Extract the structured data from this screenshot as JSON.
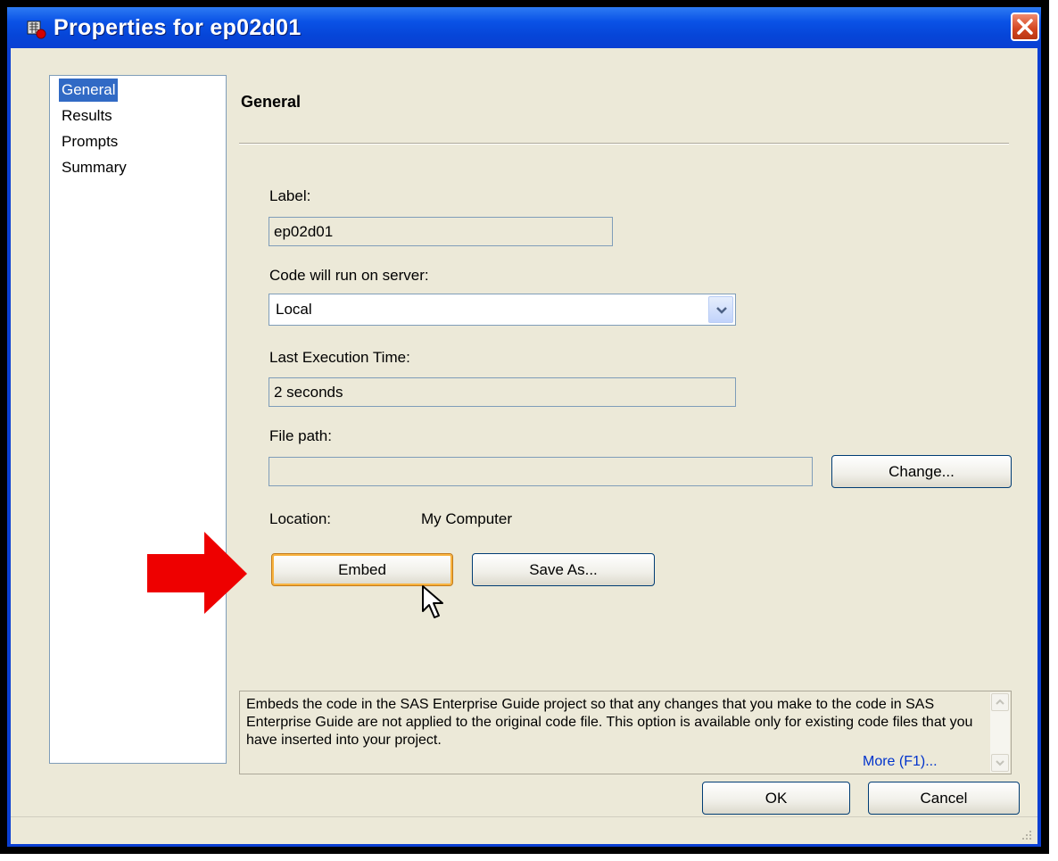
{
  "window": {
    "title": "Properties for ep02d01",
    "close_label": "Close"
  },
  "nav": {
    "items": [
      "General",
      "Results",
      "Prompts",
      "Summary"
    ],
    "selected": "General"
  },
  "section": {
    "title": "General"
  },
  "form": {
    "label_caption": "Label:",
    "label_value": "ep02d01",
    "server_caption": "Code will run on server:",
    "server_value": "Local",
    "exec_caption": "Last Execution Time:",
    "exec_value": "2 seconds",
    "filepath_caption": "File path:",
    "filepath_value": "",
    "change_button": "Change...",
    "location_caption": "Location:",
    "location_value": "My Computer",
    "embed_button": "Embed",
    "saveas_button": "Save As..."
  },
  "help": {
    "text": "Embeds the code in the SAS Enterprise Guide project so that any changes that you make to the code in SAS Enterprise Guide are not applied to the original code file. This option is available only for existing code files that you have inserted into your project.",
    "more_link": "More (F1)..."
  },
  "footer": {
    "ok_button": "OK",
    "cancel_button": "Cancel"
  },
  "colors": {
    "titlebar": "#0a52e6",
    "selection": "#316ac5",
    "annotation_arrow": "#ee0000",
    "dialog_bg": "#ece9d8"
  }
}
